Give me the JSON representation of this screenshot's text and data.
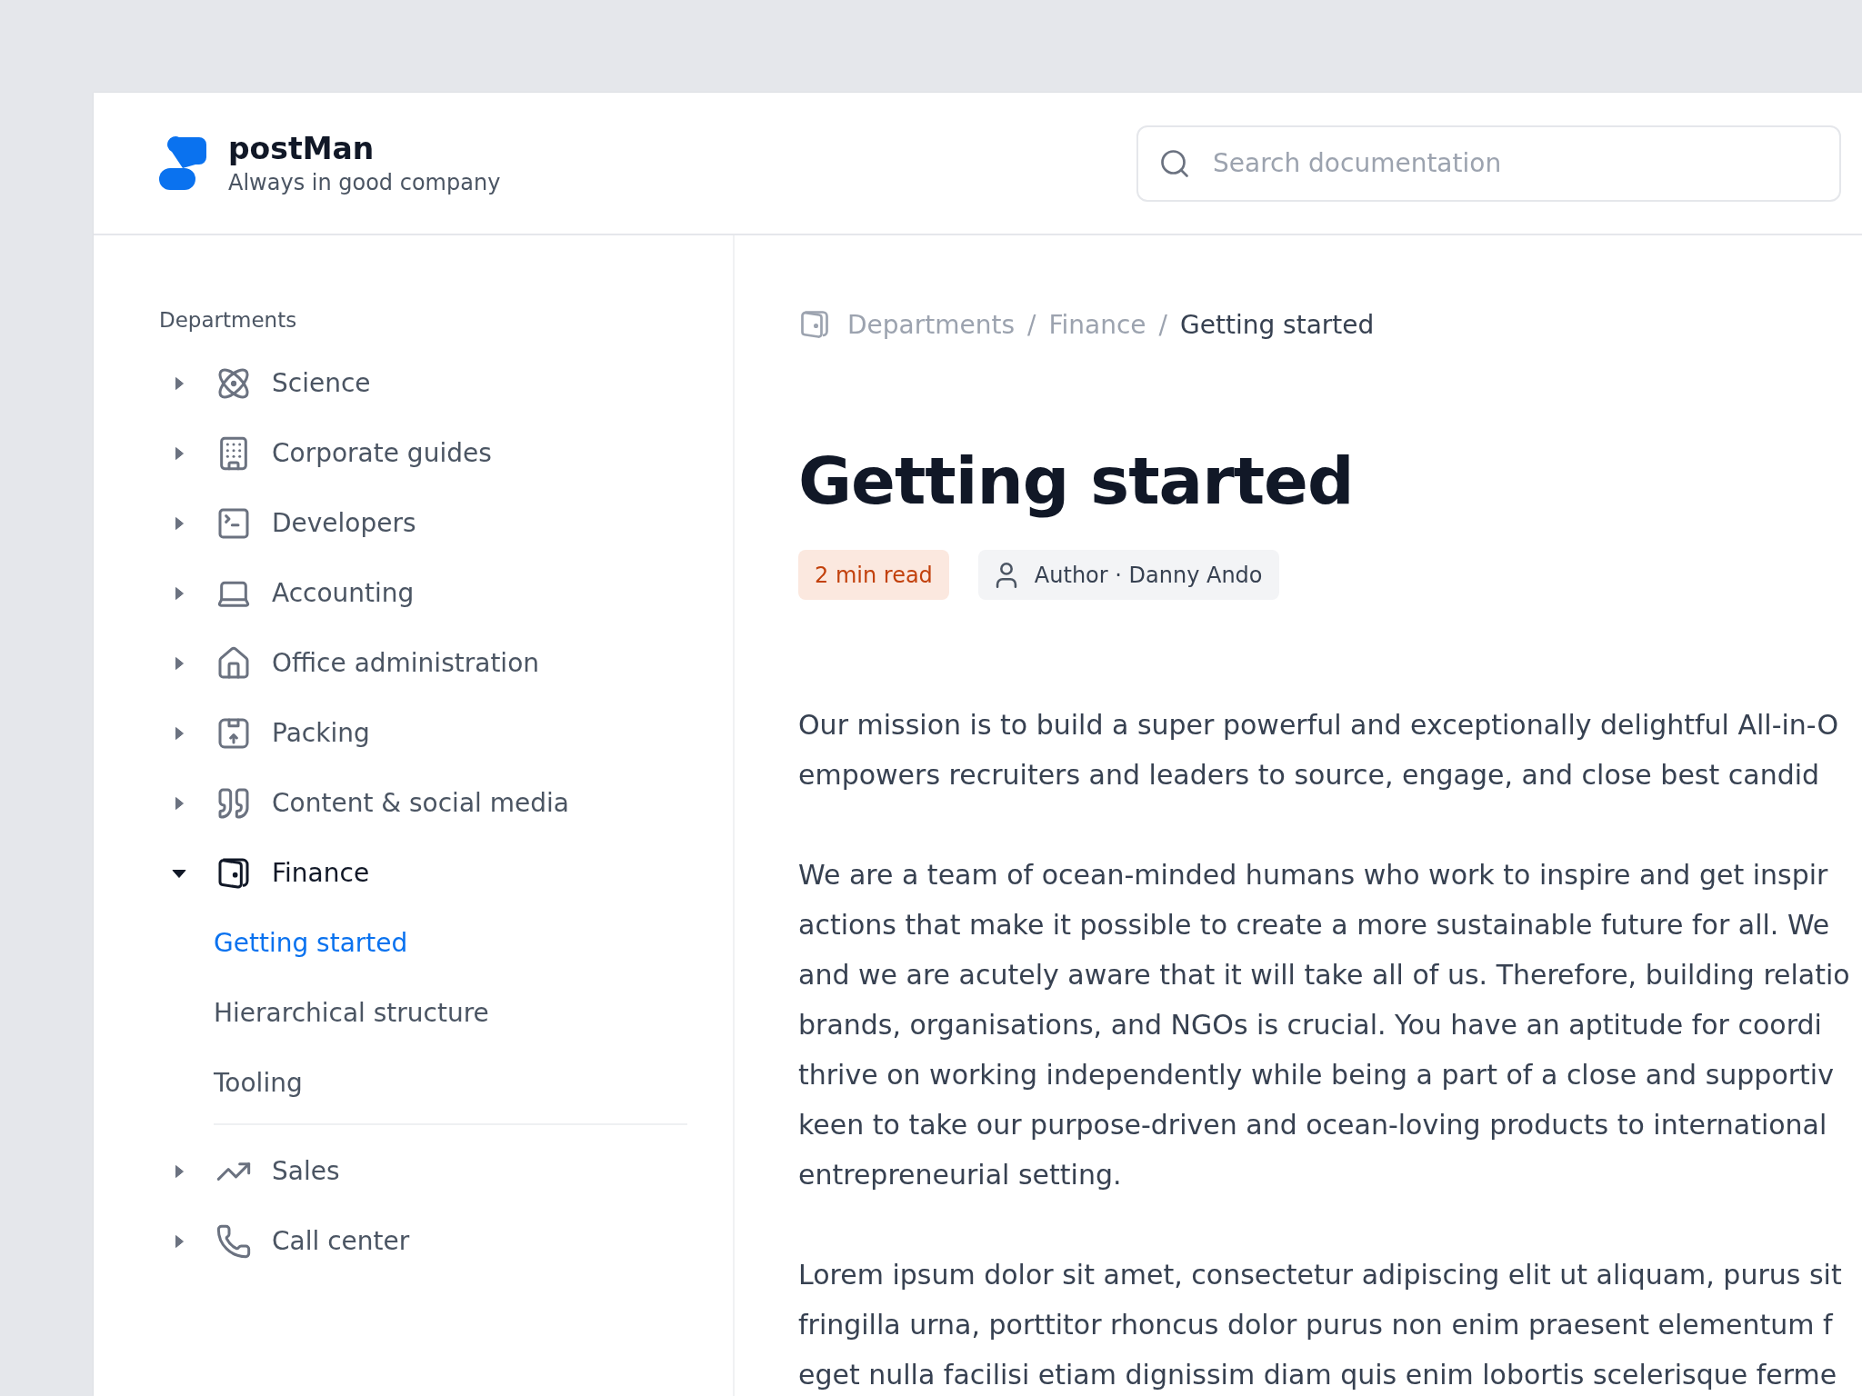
{
  "brand": {
    "name": "postMan",
    "tagline": "Always in good company"
  },
  "search": {
    "placeholder": "Search documentation"
  },
  "sidebar": {
    "heading": "Departments",
    "items": [
      {
        "label": "Science",
        "expanded": false
      },
      {
        "label": "Corporate guides",
        "expanded": false
      },
      {
        "label": "Developers",
        "expanded": false
      },
      {
        "label": "Accounting",
        "expanded": false
      },
      {
        "label": "Office administration",
        "expanded": false
      },
      {
        "label": "Packing",
        "expanded": false
      },
      {
        "label": "Content & social media",
        "expanded": false
      },
      {
        "label": "Finance",
        "expanded": true,
        "children": [
          {
            "label": "Getting started",
            "selected": true
          },
          {
            "label": "Hierarchical structure",
            "selected": false
          },
          {
            "label": "Tooling",
            "selected": false
          }
        ]
      },
      {
        "label": "Sales",
        "expanded": false
      },
      {
        "label": "Call center",
        "expanded": false
      }
    ]
  },
  "breadcrumb": {
    "items": [
      "Departments",
      "Finance",
      "Getting started"
    ],
    "separators": [
      "/",
      "/"
    ]
  },
  "article": {
    "title": "Getting started",
    "read_time": "2 min read",
    "author": "Author · Danny Ando",
    "paragraphs": [
      [
        "Our mission is to build a super powerful and exceptionally delightful All-in-O",
        "empowers recruiters and leaders to source, engage, and close best candid"
      ],
      [
        "We are a team of ocean-minded humans who work to inspire and get inspir",
        "actions that make it possible to create a more sustainable future for all. We",
        "and we are acutely aware that it will take all of us. Therefore, building relatio",
        "brands, organisations, and NGOs is crucial. You have an aptitude for coordi",
        "thrive on working independently while being a part of a close and supportiv",
        "keen to take our purpose-driven and ocean-loving products to international",
        "entrepreneurial setting."
      ],
      [
        "Lorem ipsum dolor sit amet, consectetur adipiscing elit ut aliquam, purus sit",
        "fringilla urna, porttitor rhoncus dolor purus non enim praesent elementum f",
        "eget nulla facilisi etiam dignissim diam quis enim lobortis scelerisque ferme"
      ]
    ]
  }
}
